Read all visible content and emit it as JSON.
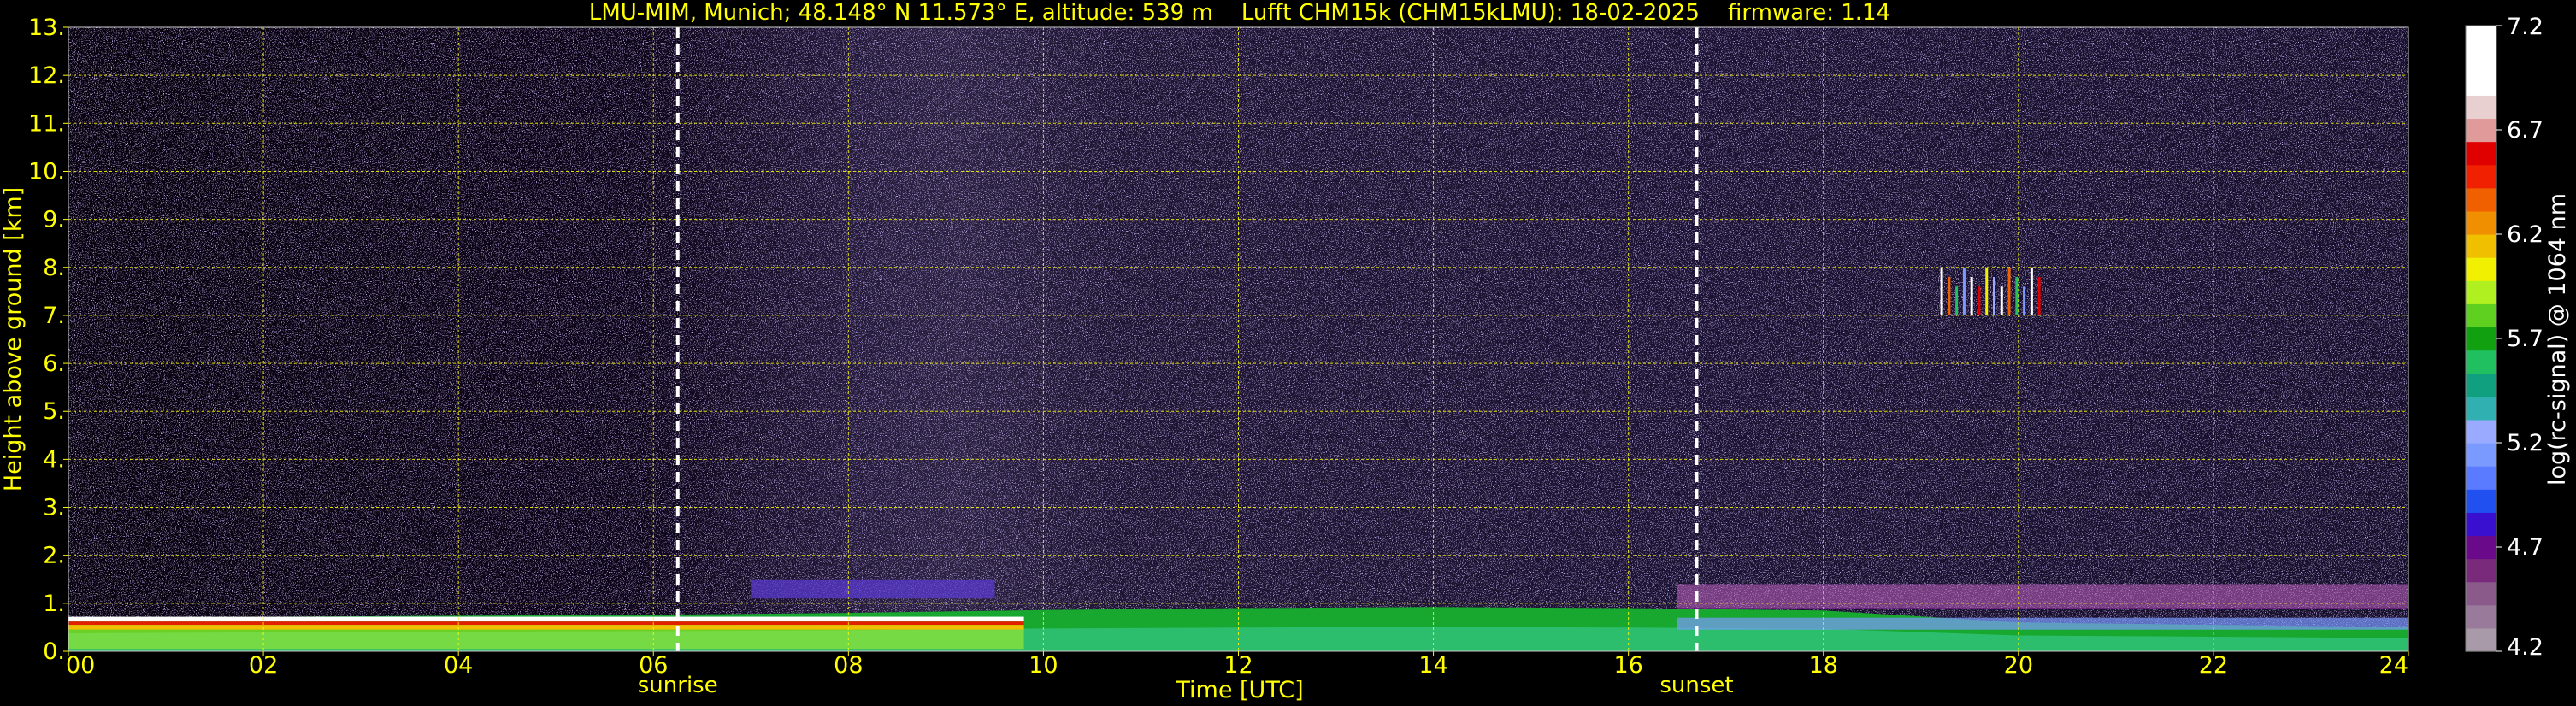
{
  "chart_data": {
    "type": "heatmap",
    "title": "LMU-MIM, Munich; 48.148° N 11.573° E, altitude: 539 m    Lufft CHM15k (CHM15kLMU): 18-02-2025    firmware: 1.14",
    "xlabel": "Time [UTC]",
    "ylabel": "Height above ground [km]",
    "xlim": [
      0,
      24
    ],
    "ylim": [
      0,
      13
    ],
    "x_ticks": [
      {
        "value": 0,
        "label": "00"
      },
      {
        "value": 2,
        "label": "02"
      },
      {
        "value": 4,
        "label": "04"
      },
      {
        "value": 6,
        "label": "06"
      },
      {
        "value": 8,
        "label": "08"
      },
      {
        "value": 10,
        "label": "10"
      },
      {
        "value": 12,
        "label": "12"
      },
      {
        "value": 14,
        "label": "14"
      },
      {
        "value": 16,
        "label": "16"
      },
      {
        "value": 18,
        "label": "18"
      },
      {
        "value": 20,
        "label": "20"
      },
      {
        "value": 22,
        "label": "22"
      },
      {
        "value": 24,
        "label": "24"
      }
    ],
    "y_ticks": [
      {
        "value": 0,
        "label": "0."
      },
      {
        "value": 1,
        "label": "1."
      },
      {
        "value": 2,
        "label": "2."
      },
      {
        "value": 3,
        "label": "3."
      },
      {
        "value": 4,
        "label": "4."
      },
      {
        "value": 5,
        "label": "5."
      },
      {
        "value": 6,
        "label": "6."
      },
      {
        "value": 7,
        "label": "7."
      },
      {
        "value": 8,
        "label": "8."
      },
      {
        "value": 9,
        "label": "9."
      },
      {
        "value": 10,
        "label": "10."
      },
      {
        "value": 11,
        "label": "11."
      },
      {
        "value": 12,
        "label": "12."
      },
      {
        "value": 13,
        "label": "13."
      }
    ],
    "grid": true,
    "grid_color": "#ffff00",
    "annotations": [
      {
        "name": "sunrise",
        "label": "sunrise",
        "x": 6.25
      },
      {
        "name": "sunset",
        "label": "sunset",
        "x": 16.7
      }
    ],
    "layers": [
      {
        "name": "near-surface-aerosol",
        "x_range": [
          0,
          24
        ],
        "y_top_km": [
          0.68,
          0.72,
          0.74,
          0.76,
          0.8,
          0.86,
          0.9,
          0.92,
          0.9,
          0.85,
          0.6,
          0.55,
          0.5
        ]
      },
      {
        "name": "elevated-layer-morning",
        "x_range": [
          7.0,
          9.5
        ],
        "y_range_km": [
          1.1,
          1.5
        ]
      },
      {
        "name": "elevated-layer-evening",
        "x_range": [
          16.5,
          24
        ],
        "y_range_km": [
          0.9,
          1.4
        ]
      },
      {
        "name": "cirrus-patch",
        "x_range": [
          19.2,
          20.2
        ],
        "y_range_km": [
          7.0,
          8.0
        ]
      }
    ],
    "colorbar": {
      "label": "log(rc-signal) @ 1064 nm",
      "min": 4.2,
      "max": 7.2,
      "ticks": [
        4.2,
        4.7,
        5.2,
        5.7,
        6.2,
        6.7,
        7.2
      ],
      "tick_labels": [
        "4.2",
        "4.7",
        "5.2",
        "5.7",
        "6.2",
        "6.7",
        "7.2"
      ],
      "colors": [
        "#a89aa8",
        "#9a7a9a",
        "#8a5a8a",
        "#7a2a7a",
        "#6a0a8a",
        "#3a10d0",
        "#2050f0",
        "#5a7aff",
        "#7a9aff",
        "#9aaaff",
        "#30b0b0",
        "#10a080",
        "#20c060",
        "#10a010",
        "#60d020",
        "#b0f020",
        "#f0f000",
        "#f0c000",
        "#f09000",
        "#f06000",
        "#f02000",
        "#e00000",
        "#e09a9a",
        "#e8d0d0",
        "#ffffff",
        "#ffffff",
        "#ffffff"
      ]
    }
  }
}
